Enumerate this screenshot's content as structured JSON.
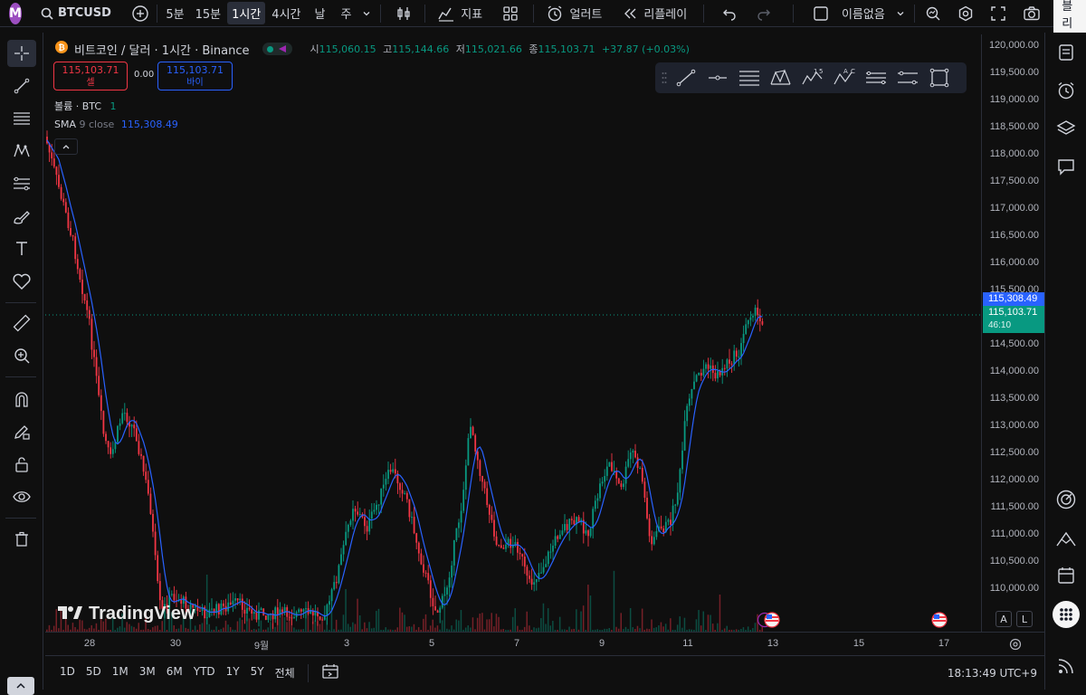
{
  "topbar": {
    "avatar_letter": "M",
    "symbol": "BTCUSD",
    "timeframes": [
      "5분",
      "15분",
      "1시간",
      "4시간",
      "날",
      "주"
    ],
    "active_timeframe": "1시간",
    "indicators_label": "지표",
    "alert_label": "얼러트",
    "replay_label": "리플레이",
    "layout_name": "이름없음",
    "publish_label": "퍼블리쉬"
  },
  "legend": {
    "title": "비트코인 / 달러 · 1시간 · Binance",
    "o_label": "시",
    "o": "115,060.15",
    "h_label": "고",
    "h": "115,144.66",
    "l_label": "저",
    "l": "115,021.66",
    "c_label": "종",
    "c": "115,103.71",
    "change": "+37.87 (+0.03%)",
    "sell_price": "115,103.71",
    "sell_label": "셀",
    "spread": "0.00",
    "buy_price": "115,103.71",
    "buy_label": "바이",
    "volume_label": "볼륨 · BTC",
    "volume_value": "1",
    "sma_label": "SMA",
    "sma_params": "9 close",
    "sma_value": "115,308.49"
  },
  "price_axis": {
    "labels": [
      "120,000.00",
      "119,500.00",
      "119,000.00",
      "118,500.00",
      "118,000.00",
      "117,500.00",
      "117,000.00",
      "116,500.00",
      "116,000.00",
      "115,500.00",
      "115,000.00",
      "114,500.00",
      "114,000.00",
      "113,500.00",
      "113,000.00",
      "112,500.00",
      "112,000.00",
      "111,500.00",
      "111,000.00",
      "110,500.00",
      "110,000.00"
    ],
    "sma_tag": "115,308.49",
    "price_tag": "115,103.71",
    "countdown": "46:10"
  },
  "time_axis": {
    "labels": [
      "28",
      "30",
      "9월",
      "3",
      "5",
      "7",
      "9",
      "11",
      "13",
      "15",
      "17"
    ]
  },
  "bottombar": {
    "ranges": [
      "1D",
      "5D",
      "1M",
      "3M",
      "6M",
      "YTD",
      "1Y",
      "5Y",
      "전체"
    ],
    "clock": "18:13:49 UTC+9"
  },
  "watermark": "TradingView",
  "scale_buttons": {
    "a": "A",
    "l": "L"
  },
  "colors": {
    "up": "#089981",
    "down": "#f23645",
    "sma": "#2962ff",
    "accent": "#2962ff"
  }
}
